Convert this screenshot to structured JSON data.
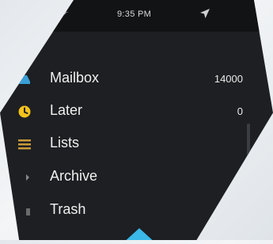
{
  "status": {
    "time": "9:35 PM",
    "left_glyph": "✈",
    "location_icon": "location-arrow-icon"
  },
  "menu": {
    "items": [
      {
        "label": "Mailbox",
        "count": "14000",
        "icon": "inbox-icon",
        "color": "#3aa0d8"
      },
      {
        "label": "Later",
        "count": "0",
        "icon": "clock-icon",
        "color": "#f3c21b"
      },
      {
        "label": "Lists",
        "count": "",
        "icon": "list-icon",
        "color": "#c99a3a"
      },
      {
        "label": "Archive",
        "count": "",
        "icon": "archive-icon",
        "color": "#8a8a8a"
      },
      {
        "label": "Trash",
        "count": "",
        "icon": "trash-icon",
        "color": "#8a8a8a"
      }
    ]
  },
  "colors": {
    "background": "#1d1f22",
    "accent": "#3ab8e8"
  }
}
